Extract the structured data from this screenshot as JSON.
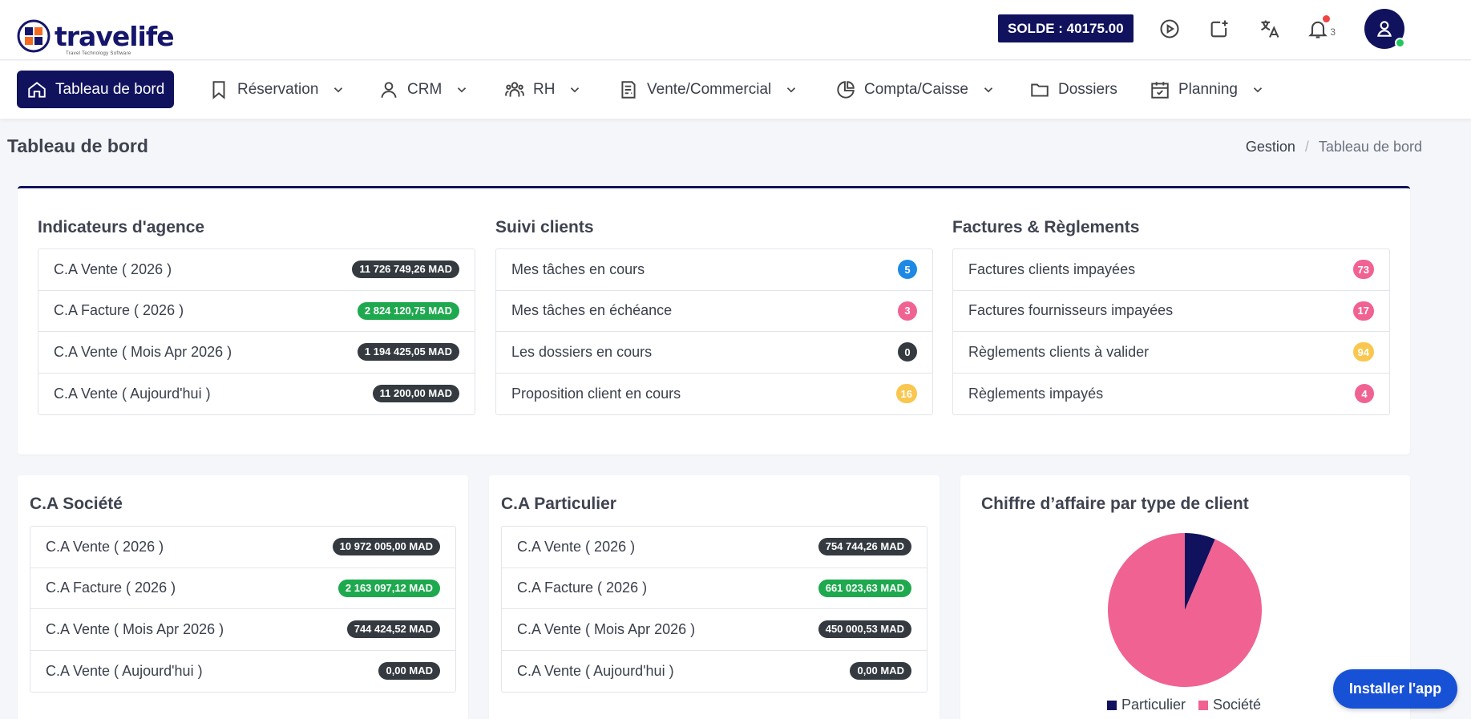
{
  "header": {
    "logo_text": "travelife",
    "logo_subtitle": "Travel Technology Software",
    "solde": "SOLDE : 40175.00",
    "notif_count": "3",
    "colors": {
      "brand": "#10125e",
      "accent": "#1751d6"
    }
  },
  "nav": {
    "items": [
      {
        "label": "Tableau de bord",
        "icon": "home-icon",
        "active": true
      },
      {
        "label": "Réservation",
        "icon": "bookmark-icon"
      },
      {
        "label": "CRM",
        "icon": "user-icon"
      },
      {
        "label": "RH",
        "icon": "users-icon"
      },
      {
        "label": "Vente/Commercial",
        "icon": "document-icon"
      },
      {
        "label": "Compta/Caisse",
        "icon": "pie-chart-icon"
      },
      {
        "label": "Dossiers",
        "icon": "folder-icon"
      },
      {
        "label": "Planning",
        "icon": "calendar-icon"
      }
    ]
  },
  "page": {
    "title": "Tableau de bord",
    "breadcrumb": [
      "Gestion",
      "Tableau de bord"
    ]
  },
  "indicateurs": {
    "title": "Indicateurs d'agence",
    "rows": [
      {
        "label": "C.A Vente ( 2026 )",
        "value": "11 726 749,26 MAD",
        "color": "dark"
      },
      {
        "label": "C.A Facture ( 2026 )",
        "value": "2 824 120,75 MAD",
        "color": "green"
      },
      {
        "label": "C.A Vente ( Mois Apr 2026 )",
        "value": "1 194 425,05 MAD",
        "color": "dark"
      },
      {
        "label": "C.A Vente ( Aujourd'hui )",
        "value": "11 200,00 MAD",
        "color": "dark"
      }
    ]
  },
  "suivi": {
    "title": "Suivi clients",
    "rows": [
      {
        "label": "Mes tâches en cours",
        "value": "5",
        "color": "#1e88e5"
      },
      {
        "label": "Mes tâches en échéance",
        "value": "3",
        "color": "#f06292"
      },
      {
        "label": "Les dossiers en cours",
        "value": "0",
        "color": "#343a40"
      },
      {
        "label": "Proposition client en cours",
        "value": "16",
        "color": "#f9c74f"
      }
    ]
  },
  "factures": {
    "title": "Factures & Règlements",
    "rows": [
      {
        "label": "Factures clients impayées",
        "value": "73",
        "color": "#f06292"
      },
      {
        "label": "Factures fournisseurs impayées",
        "value": "17",
        "color": "#f06292"
      },
      {
        "label": "Règlements clients à valider",
        "value": "94",
        "color": "#f9c74f"
      },
      {
        "label": "Règlements impayés",
        "value": "4",
        "color": "#f06292"
      }
    ]
  },
  "societe": {
    "title": "C.A Société",
    "rows": [
      {
        "label": "C.A Vente ( 2026 )",
        "value": "10 972 005,00 MAD",
        "color": "dark"
      },
      {
        "label": "C.A Facture ( 2026 )",
        "value": "2 163 097,12 MAD",
        "color": "green"
      },
      {
        "label": "C.A Vente ( Mois Apr 2026 )",
        "value": "744 424,52 MAD",
        "color": "dark"
      },
      {
        "label": "C.A Vente ( Aujourd'hui )",
        "value": "0,00 MAD",
        "color": "dark"
      }
    ]
  },
  "particulier": {
    "title": "C.A Particulier",
    "rows": [
      {
        "label": "C.A Vente ( 2026 )",
        "value": "754 744,26 MAD",
        "color": "dark"
      },
      {
        "label": "C.A Facture ( 2026 )",
        "value": "661 023,63 MAD",
        "color": "green"
      },
      {
        "label": "C.A Vente ( Mois Apr 2026 )",
        "value": "450 000,53 MAD",
        "color": "dark"
      },
      {
        "label": "C.A Vente ( Aujourd'hui )",
        "value": "0,00 MAD",
        "color": "dark"
      }
    ]
  },
  "chart_data": {
    "type": "pie",
    "title": "Chiffre d’affaire par type de client",
    "categories": [
      "Particulier",
      "Société"
    ],
    "values": [
      754744.26,
      10972005.0
    ],
    "colors": [
      "#10125e",
      "#f06292"
    ],
    "legend": "bottom"
  },
  "install_label": "Installer l'app"
}
